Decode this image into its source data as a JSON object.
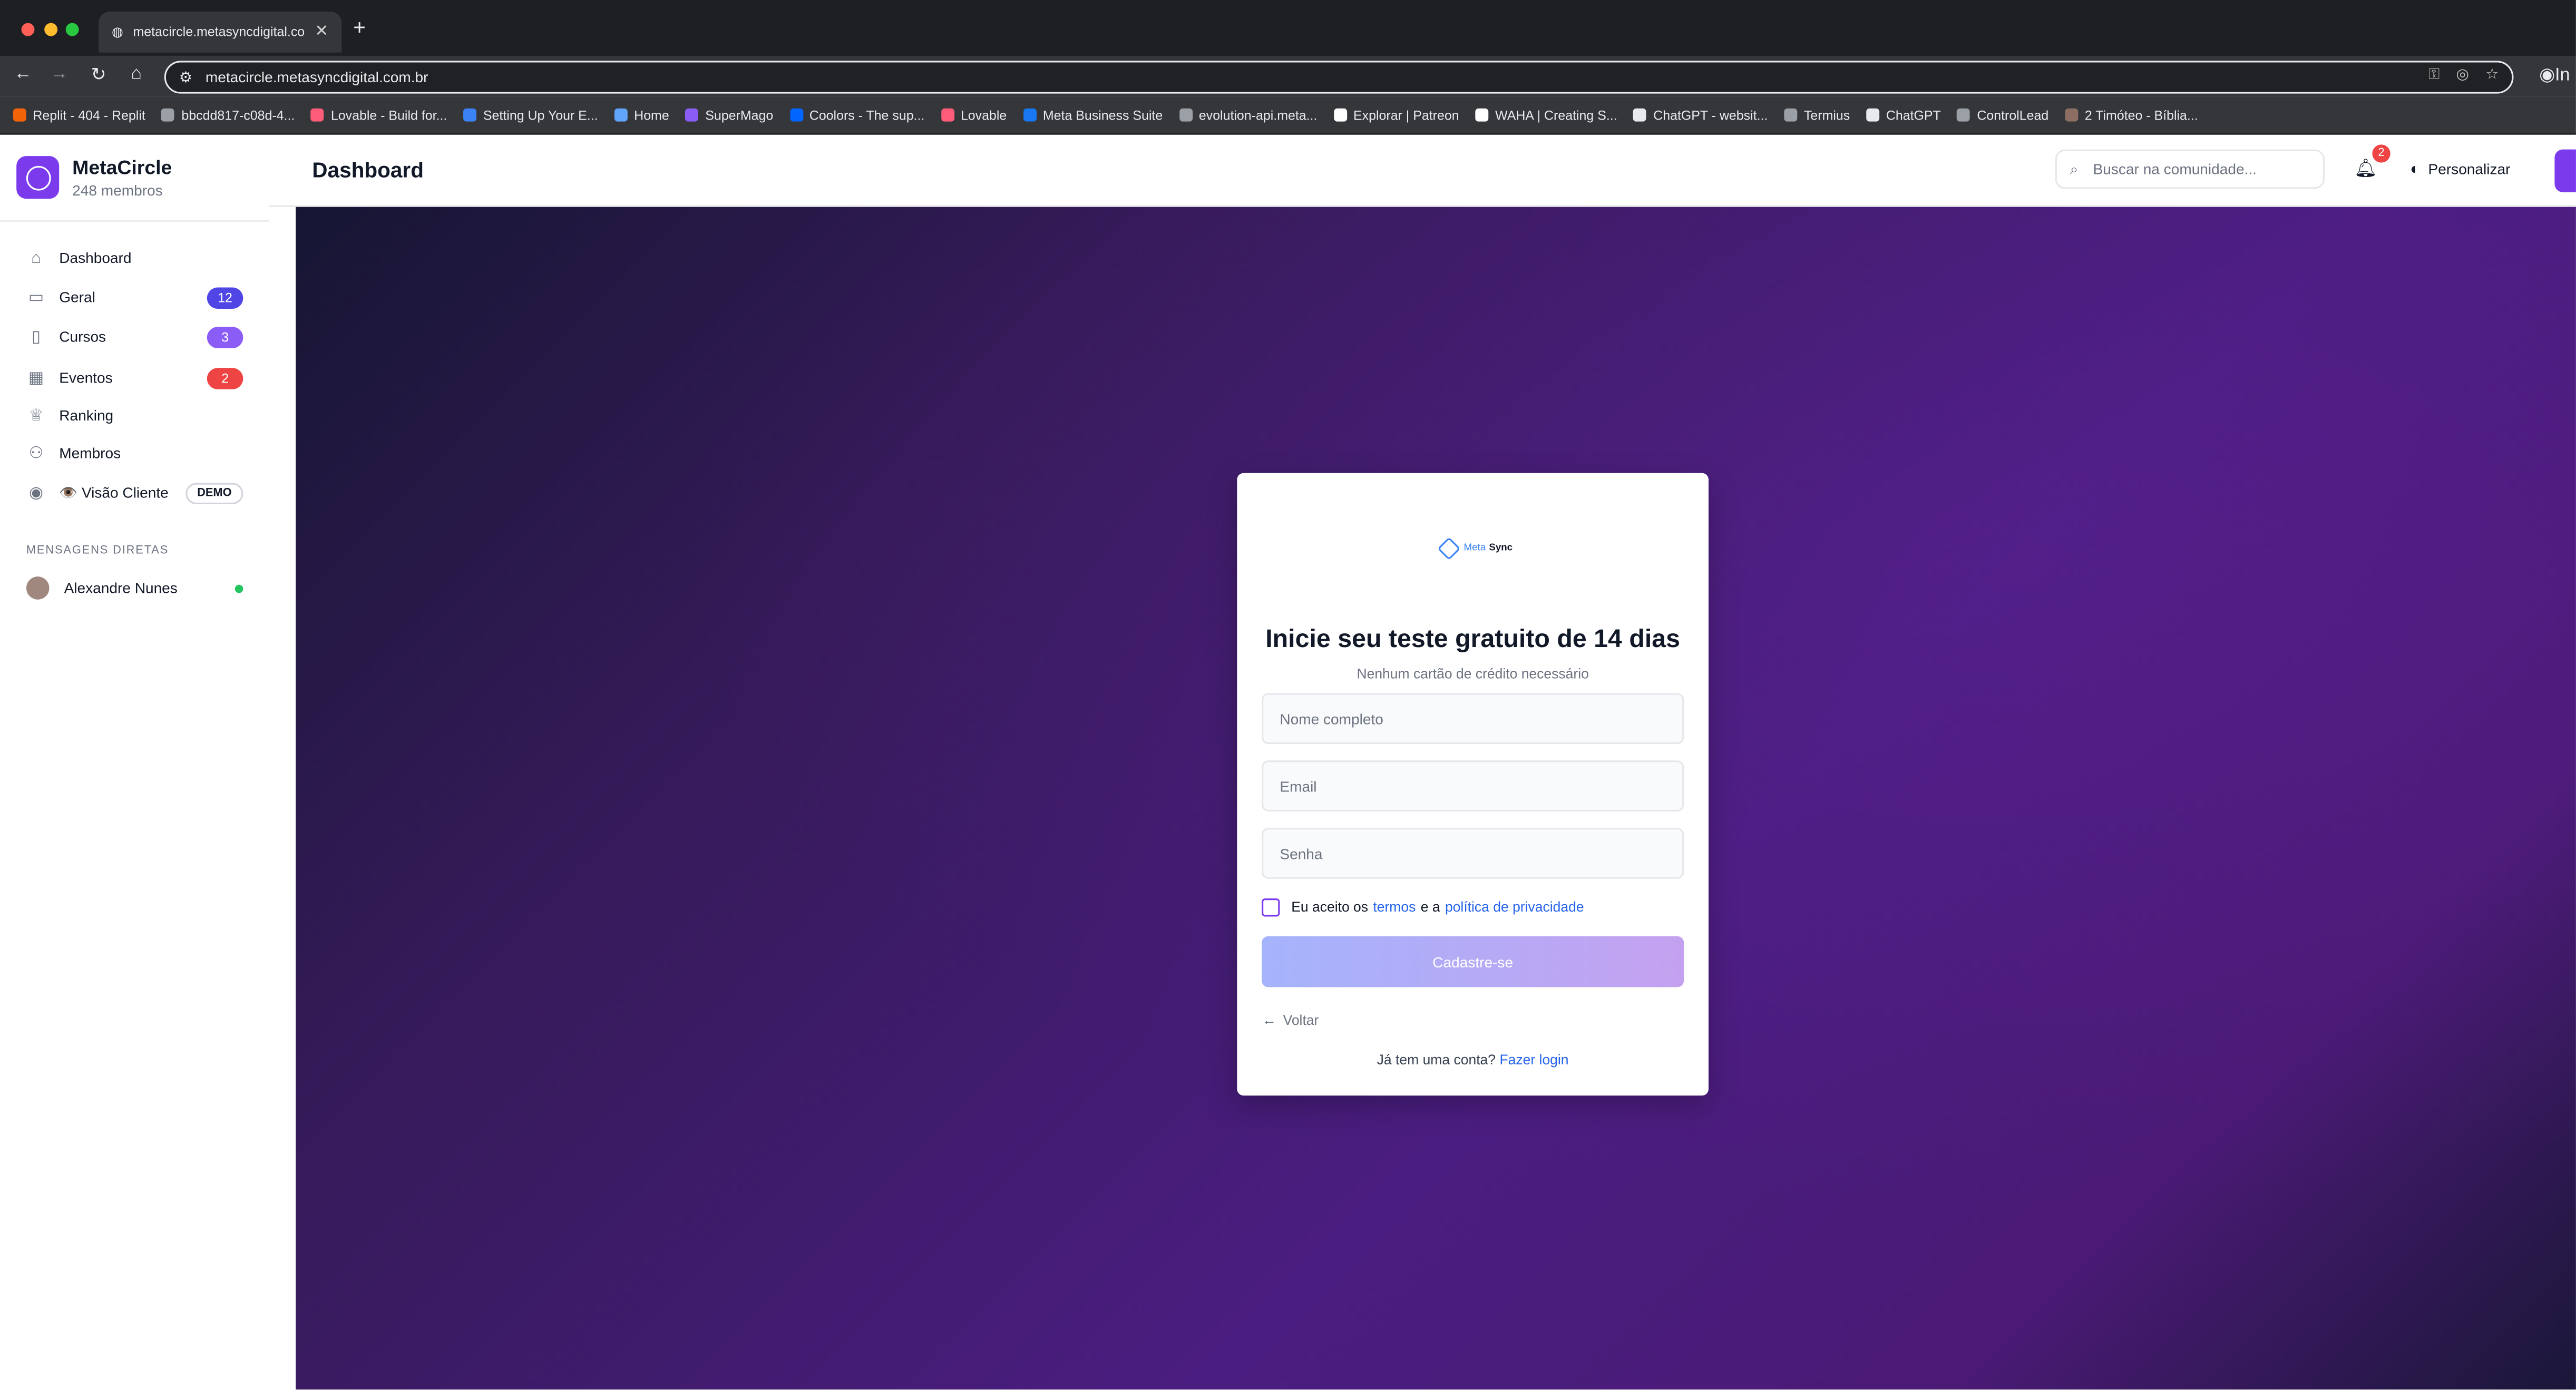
{
  "browser": {
    "tab_title": "metacircle.metasyncdigital.co",
    "url": "metacircle.metasyncdigital.com.br",
    "bookmarks": [
      {
        "label": "Replit - 404 - Replit",
        "color": "#f26207"
      },
      {
        "label": "bbcdd817-c08d-4...",
        "color": "#9aa0a6"
      },
      {
        "label": "Lovable - Build for...",
        "color": "#ff5c7a"
      },
      {
        "label": "Setting Up Your E...",
        "color": "#3b82f6"
      },
      {
        "label": "Home",
        "color": "#60a5fa"
      },
      {
        "label": "SuperMago",
        "color": "#8b5cf6"
      },
      {
        "label": "Coolors - The sup...",
        "color": "#0066ff"
      },
      {
        "label": "Lovable",
        "color": "#ff5c7a"
      },
      {
        "label": "Meta Business Suite",
        "color": "#1877f2"
      },
      {
        "label": "evolution-api.meta...",
        "color": "#9aa0a6"
      },
      {
        "label": "Explorar | Patreon",
        "color": "#ffffff"
      },
      {
        "label": "WAHA | Creating S...",
        "color": "#ffffff"
      },
      {
        "label": "ChatGPT - websit...",
        "color": "#e8eaed"
      },
      {
        "label": "Termius",
        "color": "#9aa0a6"
      },
      {
        "label": "ChatGPT",
        "color": "#e8eaed"
      },
      {
        "label": "ControlLead",
        "color": "#9aa0a6"
      },
      {
        "label": "2 Timóteo - Bíblia...",
        "color": "#8d6e63"
      }
    ],
    "right_partial": "In"
  },
  "sidebar": {
    "brand_name": "MetaCircle",
    "brand_sub": "248 membros",
    "items": [
      {
        "label": "Dashboard",
        "icon": "home-icon"
      },
      {
        "label": "Geral",
        "icon": "chat-icon",
        "badge": "12",
        "badge_color": "#4f46e5"
      },
      {
        "label": "Cursos",
        "icon": "book-icon",
        "badge": "3",
        "badge_color": "#8b5cf6"
      },
      {
        "label": "Eventos",
        "icon": "calendar-icon",
        "badge": "2",
        "badge_color": "#ef4444"
      },
      {
        "label": "Ranking",
        "icon": "trophy-icon"
      },
      {
        "label": "Membros",
        "icon": "users-icon"
      },
      {
        "label": "👁️ Visão Cliente",
        "icon": "eye-icon",
        "tag": "DEMO"
      }
    ],
    "dm_title": "MENSAGENS DIRETAS",
    "dm_user": "Alexandre Nunes"
  },
  "header": {
    "title": "Dashboard",
    "search_placeholder": "Buscar na comunidade...",
    "notifications": "2",
    "personalize": "Personalizar"
  },
  "signup": {
    "logo_a": "Meta",
    "logo_b": "Sync",
    "title": "Inicie seu teste gratuito de 14 dias",
    "subtitle": "Nenhum cartão de crédito necessário",
    "name_placeholder": "Nome completo",
    "email_placeholder": "Email",
    "password_placeholder": "Senha",
    "terms_prefix": "Eu aceito os",
    "terms_link": "termos",
    "terms_mid": "e a",
    "privacy_link": "política de privacidade",
    "submit": "Cadastre-se",
    "back": "Voltar",
    "login_prompt": "Já tem uma conta?",
    "login_link": "Fazer login"
  }
}
